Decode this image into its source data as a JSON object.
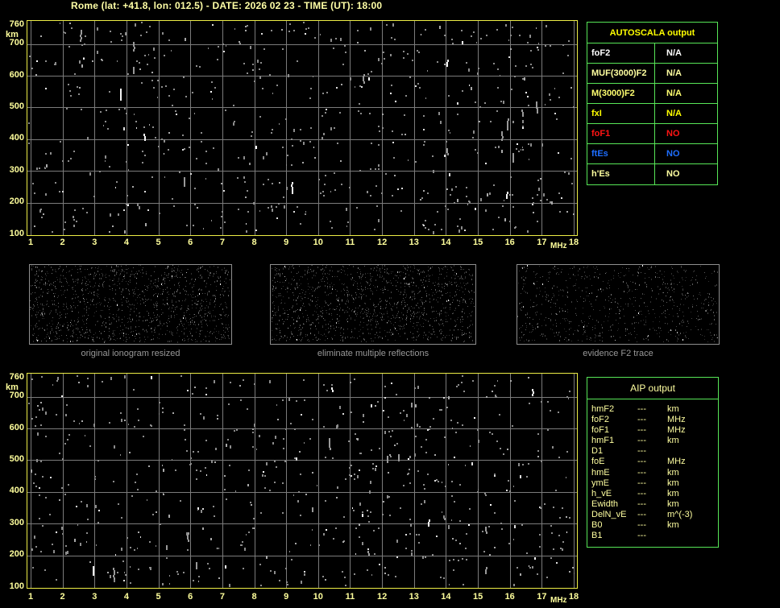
{
  "header": {
    "title": "Rome (lat: +41.8, lon: 012.5) - DATE: 2026 02 23 - TIME (UT): 18:00"
  },
  "colors": {
    "background": "#000000",
    "title_text": "#ffffa6",
    "plot_border": "#eded46",
    "grid": "#7b7b7b",
    "tick_text": "#ffff9c",
    "table_border": "#57e657",
    "autoscala_header": "#ffff00",
    "aip_text": "#ffffa0",
    "caption_text": "#989898",
    "thumbnail_border": "#8f8f8f",
    "noise_gray": "#8c8c8c"
  },
  "ionograms": {
    "top": {
      "y_unit": "km",
      "x_unit": "MHz",
      "yticks": [
        760,
        700,
        600,
        500,
        400,
        300,
        200,
        100
      ],
      "xticks": [
        1,
        2,
        3,
        4,
        5,
        6,
        7,
        8,
        9,
        10,
        11,
        12,
        13,
        14,
        15,
        16,
        17,
        18
      ]
    },
    "bottom": {
      "y_unit": "km",
      "x_unit": "MHz",
      "yticks": [
        760,
        700,
        600,
        500,
        400,
        300,
        200,
        100
      ],
      "xticks": [
        1,
        2,
        3,
        4,
        5,
        6,
        7,
        8,
        9,
        10,
        11,
        12,
        13,
        14,
        15,
        16,
        17,
        18
      ]
    }
  },
  "autoscala": {
    "title": "AUTOSCALA output",
    "rows": [
      {
        "label": "foF2",
        "value": "N/A",
        "color": "#ffffff"
      },
      {
        "label": "MUF(3000)F2",
        "value": "N/A",
        "color": "#ffffa0"
      },
      {
        "label": "M(3000)F2",
        "value": "N/A",
        "color": "#ffff70"
      },
      {
        "label": "fxI",
        "value": "N/A",
        "color": "#ffff00"
      },
      {
        "label": "foF1",
        "value": "NO",
        "color": "#ff1414"
      },
      {
        "label": "ftEs",
        "value": "NO",
        "color": "#1e6eff"
      },
      {
        "label": "h'Es",
        "value": "NO",
        "color": "#ffffa0"
      }
    ]
  },
  "thumbnails": [
    {
      "caption": "original ionogram resized"
    },
    {
      "caption": "eliminate multiple reflections"
    },
    {
      "caption": "evidence F2 trace"
    }
  ],
  "aip": {
    "title": "AIP output",
    "rows": [
      {
        "label": "hmF2",
        "value": "---",
        "unit": "km"
      },
      {
        "label": "foF2",
        "value": "---",
        "unit": "MHz"
      },
      {
        "label": "foF1",
        "value": "---",
        "unit": "MHz"
      },
      {
        "label": "hmF1",
        "value": "---",
        "unit": "km"
      },
      {
        "label": "D1",
        "value": "---",
        "unit": ""
      },
      {
        "label": "foE",
        "value": "---",
        "unit": "MHz"
      },
      {
        "label": "hmE",
        "value": "---",
        "unit": "km"
      },
      {
        "label": "ymE",
        "value": "---",
        "unit": "km"
      },
      {
        "label": "h_vE",
        "value": "---",
        "unit": "km"
      },
      {
        "label": "Ewidth",
        "value": "---",
        "unit": "km"
      },
      {
        "label": "DelN_vE",
        "value": "---",
        "unit": "m^(-3)"
      },
      {
        "label": "B0",
        "value": "---",
        "unit": "km"
      },
      {
        "label": "B1",
        "value": "---",
        "unit": ""
      }
    ]
  },
  "chart_data": [
    {
      "type": "scatter",
      "title": "ionogram (autoscaling view, top)",
      "xlabel": "MHz",
      "ylabel": "km",
      "xlim": [
        1,
        18
      ],
      "ylim": [
        100,
        760
      ],
      "xticks": [
        1,
        2,
        3,
        4,
        5,
        6,
        7,
        8,
        9,
        10,
        11,
        12,
        13,
        14,
        15,
        16,
        17,
        18
      ],
      "yticks": [
        760,
        700,
        600,
        500,
        400,
        300,
        200,
        100
      ],
      "grid": true,
      "series": [],
      "content_note": "sparse uniform background noise speckle only; no ionospheric echo trace present (all scaled parameters N/A / NO)"
    },
    {
      "type": "scatter",
      "title": "ionogram (AIP view, bottom)",
      "xlabel": "MHz",
      "ylabel": "km",
      "xlim": [
        1,
        18
      ],
      "ylim": [
        100,
        760
      ],
      "xticks": [
        1,
        2,
        3,
        4,
        5,
        6,
        7,
        8,
        9,
        10,
        11,
        12,
        13,
        14,
        15,
        16,
        17,
        18
      ],
      "yticks": [
        760,
        700,
        600,
        500,
        400,
        300,
        200,
        100
      ],
      "grid": true,
      "series": [],
      "content_note": "sparse uniform background noise speckle only; no profile computed (all AIP parameters ---)"
    }
  ]
}
